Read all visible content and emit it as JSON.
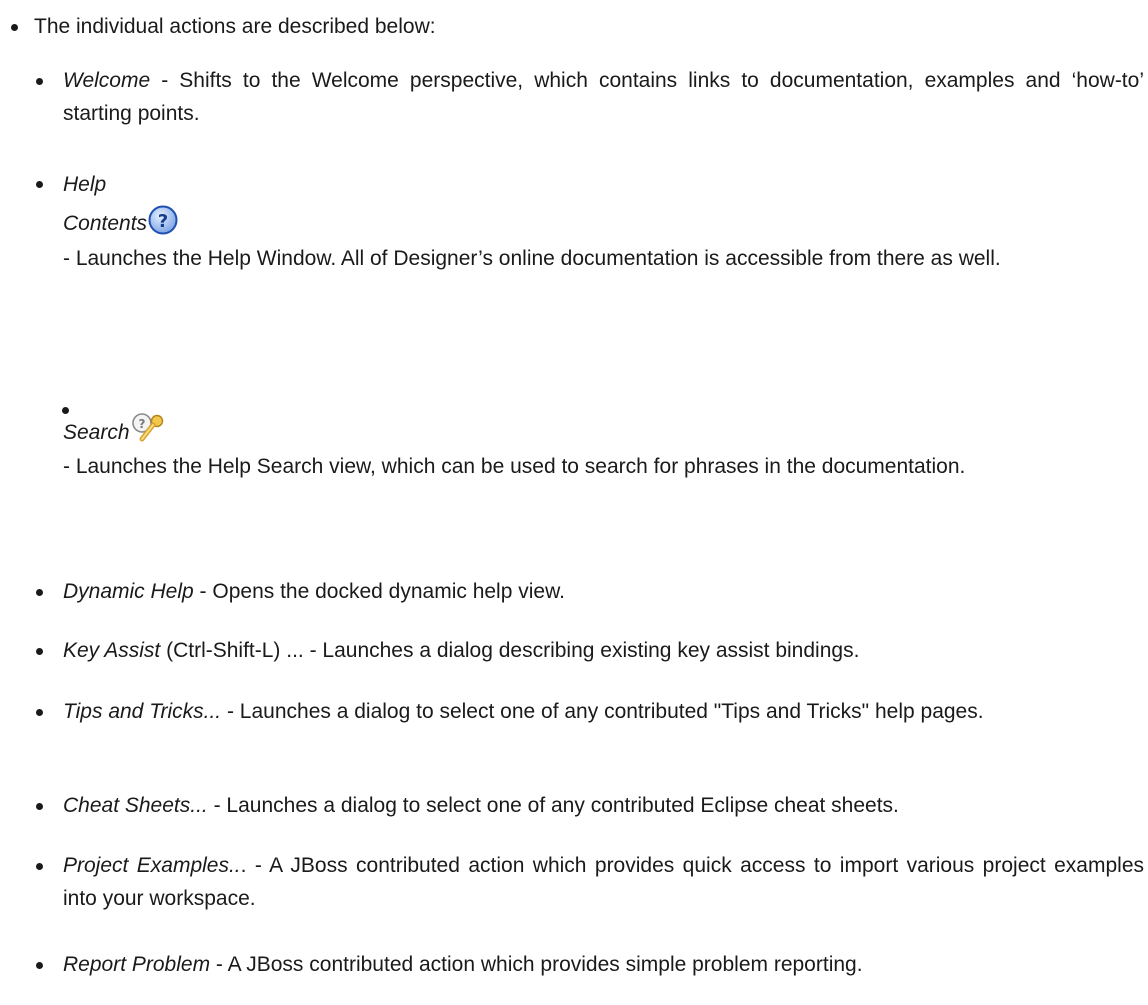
{
  "intro": "The individual actions are described below:",
  "items": [
    {
      "term": "Welcome",
      "desc": " - Shifts to the Welcome perspective, which contains links to documentation, examples and ‘how-to’ starting points."
    },
    {
      "term_line1": "Help",
      "term_line2": "Contents",
      "icon": "help-contents-icon",
      "desc": "- Launches the Help Window. All of Designer’s online documentation is accessible from there as well."
    },
    {
      "term": "Search",
      "icon": "help-search-icon",
      "desc": "- Launches the Help Search view, which can be used to search for phrases in the documentation."
    },
    {
      "term": "Dynamic Help",
      "desc": " - Opens the docked dynamic help view."
    },
    {
      "term": "Key Assist",
      "desc": " (Ctrl-Shift-L) ... - Launches a dialog describing existing key assist bindings."
    },
    {
      "term": "Tips and Tricks...",
      "desc": " - Launches a dialog to select one of any contributed \"Tips and Tricks\" help pages."
    },
    {
      "term": "Cheat Sheets...",
      "desc": " - Launches a dialog to select one of any contributed Eclipse cheat sheets."
    },
    {
      "term": "Project Examples..",
      "desc": ". - A JBoss contributed action which provides quick access to import various project examples into your workspace."
    },
    {
      "term": "Report Problem",
      "desc": " - A JBoss contributed action which provides simple problem reporting."
    }
  ]
}
